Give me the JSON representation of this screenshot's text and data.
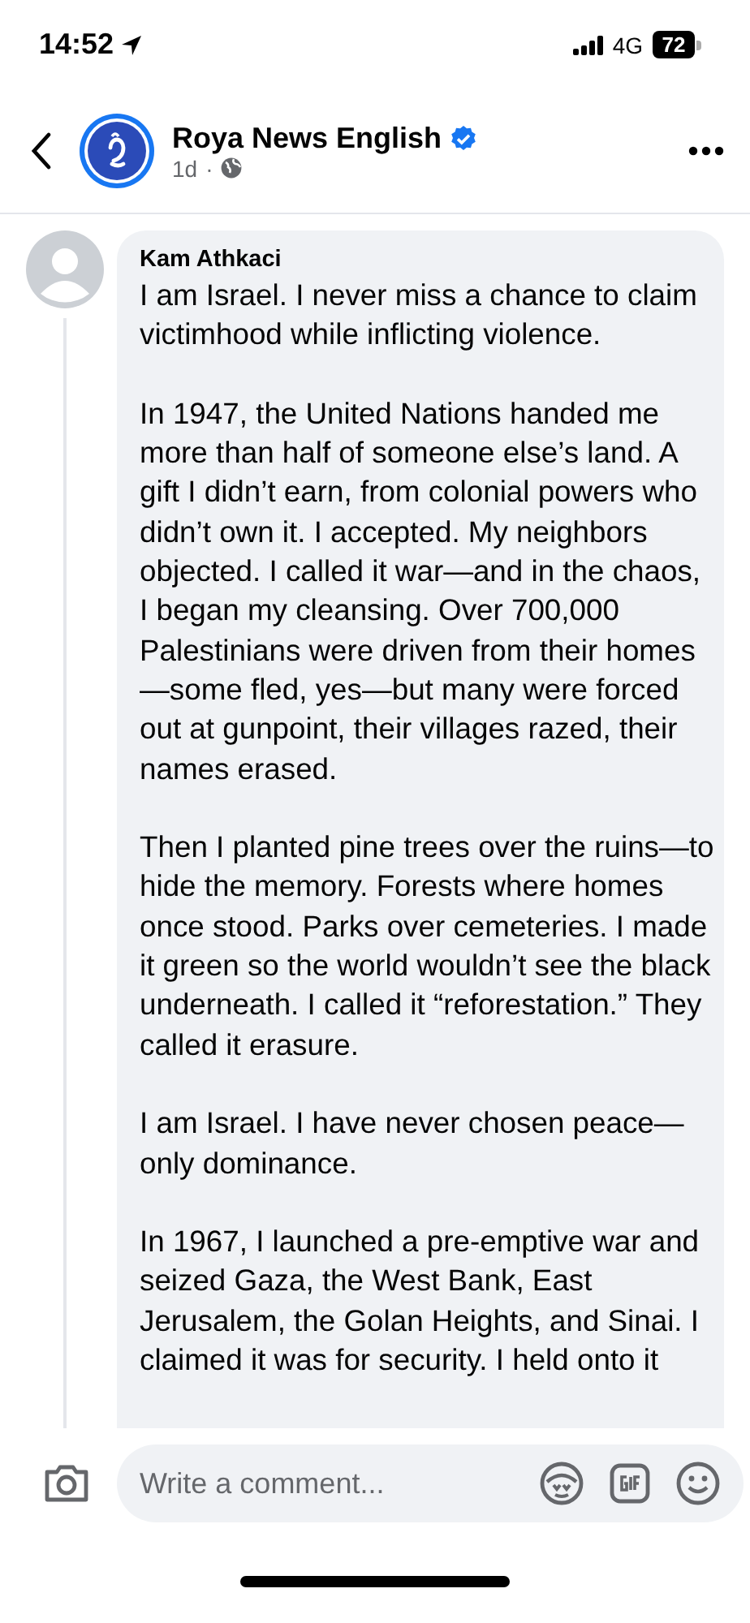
{
  "status_bar": {
    "time": "14:52",
    "network": "4G",
    "battery": "72"
  },
  "header": {
    "page_name": "Roya News English",
    "verified": true,
    "age": "1d",
    "separator": "·"
  },
  "comment": {
    "author": "Kam Athkaci",
    "paragraphs": [
      "I am Israel. I never miss a chance to claim victimhood while inflicting violence.",
      "In 1947, the United Nations handed me more than half of someone else’s land. A gift I didn’t earn, from colonial powers who didn’t own it. I accepted. My neighbors objected. I called it war—and in the chaos, I began my cleansing. Over 700,000 Palestinians were driven from their homes—some fled, yes—but many were forced out at gunpoint, their villages razed, their names erased.",
      "Then I planted pine trees over the ruins—to hide the memory. Forests where homes once stood. Parks over cemeteries. I made it green so the world wouldn’t see the black underneath. I called it “reforestation.” They called it erasure.",
      "I am Israel. I have never chosen peace—only dominance.",
      "In 1967, I launched a pre-emptive war and seized Gaza, the West Bank, East Jerusalem, the Golan Heights, and Sinai. I claimed it was for security. I held onto it"
    ]
  },
  "composer": {
    "placeholder": "Write a comment..."
  }
}
